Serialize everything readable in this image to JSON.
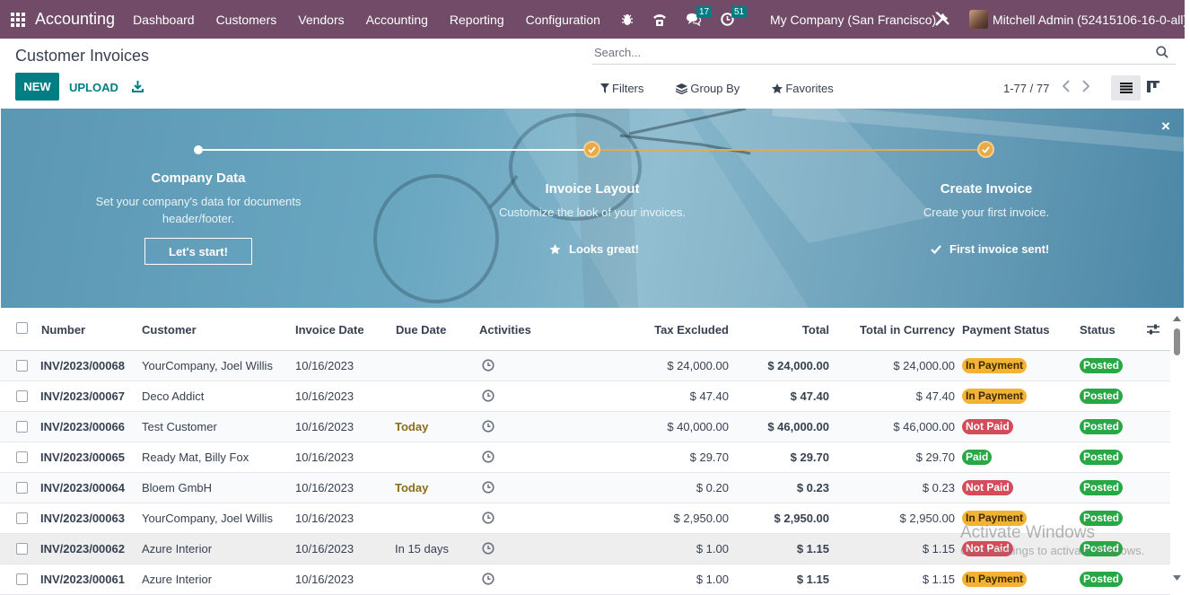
{
  "navbar": {
    "app_name": "Accounting",
    "menu": [
      "Dashboard",
      "Customers",
      "Vendors",
      "Accounting",
      "Reporting",
      "Configuration"
    ],
    "messages_count": "17",
    "activities_count": "51",
    "company": "My Company (San Francisco)",
    "user": "Mitchell Admin (52415106-16-0-all)"
  },
  "control_panel": {
    "title": "Customer Invoices",
    "new_label": "NEW",
    "upload_label": "UPLOAD",
    "search_placeholder": "Search...",
    "filters_label": "Filters",
    "group_by_label": "Group By",
    "favorites_label": "Favorites",
    "pager": "1-77 / 77"
  },
  "onboarding": {
    "steps": [
      {
        "title": "Company Data",
        "description": "Set your company's data for documents header/footer.",
        "action": "Let's start!",
        "done": false
      },
      {
        "title": "Invoice Layout",
        "description": "Customize the look of your invoices.",
        "action": "Looks great!",
        "done": true
      },
      {
        "title": "Create Invoice",
        "description": "Create your first invoice.",
        "action": "First invoice sent!",
        "done": true
      }
    ],
    "close": "×"
  },
  "table": {
    "columns": [
      "Number",
      "Customer",
      "Invoice Date",
      "Due Date",
      "Activities",
      "Tax Excluded",
      "Total",
      "Total in Currency",
      "Payment Status",
      "Status"
    ],
    "rows": [
      {
        "number": "INV/2023/00068",
        "customer": "YourCompany, Joel Willis",
        "invoice_date": "10/16/2023",
        "due_date": "",
        "tax_excluded": "$ 24,000.00",
        "total": "$ 24,000.00",
        "total_currency": "$ 24,000.00",
        "payment_status": "In Payment",
        "status": "Posted"
      },
      {
        "number": "INV/2023/00067",
        "customer": "Deco Addict",
        "invoice_date": "10/16/2023",
        "due_date": "",
        "tax_excluded": "$ 47.40",
        "total": "$ 47.40",
        "total_currency": "$ 47.40",
        "payment_status": "In Payment",
        "status": "Posted"
      },
      {
        "number": "INV/2023/00066",
        "customer": "Test Customer",
        "invoice_date": "10/16/2023",
        "due_date": "Today",
        "tax_excluded": "$ 40,000.00",
        "total": "$ 46,000.00",
        "total_currency": "$ 46,000.00",
        "payment_status": "Not Paid",
        "status": "Posted"
      },
      {
        "number": "INV/2023/00065",
        "customer": "Ready Mat, Billy Fox",
        "invoice_date": "10/16/2023",
        "due_date": "",
        "tax_excluded": "$ 29.70",
        "total": "$ 29.70",
        "total_currency": "$ 29.70",
        "payment_status": "Paid",
        "status": "Posted"
      },
      {
        "number": "INV/2023/00064",
        "customer": "Bloem GmbH",
        "invoice_date": "10/16/2023",
        "due_date": "Today",
        "tax_excluded": "$ 0.20",
        "total": "$ 0.23",
        "total_currency": "$ 0.23",
        "payment_status": "Not Paid",
        "status": "Posted"
      },
      {
        "number": "INV/2023/00063",
        "customer": "YourCompany, Joel Willis",
        "invoice_date": "10/16/2023",
        "due_date": "",
        "tax_excluded": "$ 2,950.00",
        "total": "$ 2,950.00",
        "total_currency": "$ 2,950.00",
        "payment_status": "In Payment",
        "status": "Posted"
      },
      {
        "number": "INV/2023/00062",
        "customer": "Azure Interior",
        "invoice_date": "10/16/2023",
        "due_date": "In 15 days",
        "tax_excluded": "$ 1.00",
        "total": "$ 1.15",
        "total_currency": "$ 1.15",
        "payment_status": "Not Paid",
        "status": "Posted"
      },
      {
        "number": "INV/2023/00061",
        "customer": "Azure Interior",
        "invoice_date": "10/16/2023",
        "due_date": "",
        "tax_excluded": "$ 1.00",
        "total": "$ 1.15",
        "total_currency": "$ 1.15",
        "payment_status": "In Payment",
        "status": "Posted"
      }
    ]
  },
  "watermark": {
    "line1": "Activate Windows",
    "line2": "Go to Settings to activate Windows."
  },
  "colors": {
    "navbar": "#714b67",
    "primary": "#017e84",
    "in_payment": "#f3b233",
    "not_paid": "#d44c59",
    "paid": "#28a745",
    "posted": "#28a745",
    "step_done": "#e8a947"
  }
}
